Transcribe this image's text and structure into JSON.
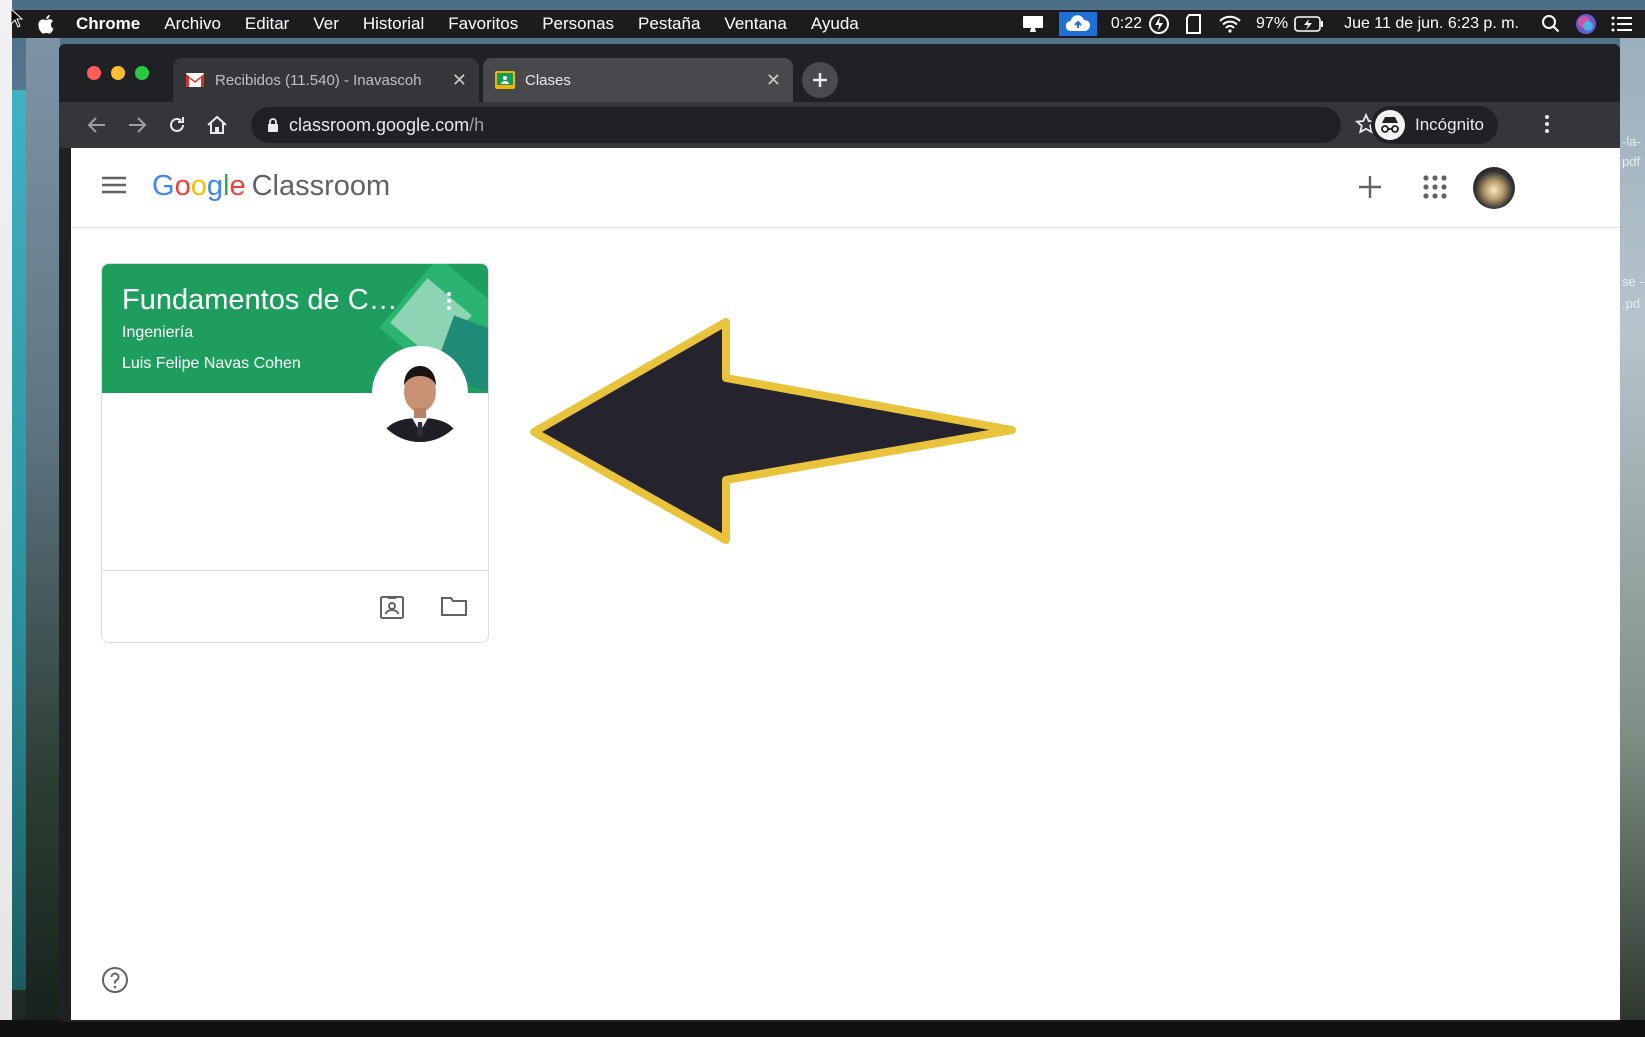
{
  "menubar": {
    "app": "Chrome",
    "items": [
      "Archivo",
      "Editar",
      "Ver",
      "Historial",
      "Favoritos",
      "Personas",
      "Pestaña",
      "Ventana",
      "Ayuda"
    ],
    "timer": "0:22",
    "battery": "97%",
    "datetime": "Jue 11 de jun.  6:23 p. m."
  },
  "browser": {
    "tabs": [
      {
        "title": "Recibidos (11.540) - Inavascoh",
        "icon": "gmail-icon"
      },
      {
        "title": "Clases",
        "icon": "classroom-icon"
      }
    ],
    "url_host": "classroom.google.com",
    "url_path": "/h",
    "profile_label": "Incógnito"
  },
  "classroom": {
    "logo_google": [
      "G",
      "o",
      "o",
      "g",
      "l",
      "e"
    ],
    "logo_colors": [
      "#4285F4",
      "#EA4335",
      "#FBBC05",
      "#4285F4",
      "#34A853",
      "#EA4335"
    ],
    "logo_product": "Classroom",
    "card": {
      "title": "Fundamentos de Cál...",
      "section": "Ingeniería",
      "teacher": "Luis Felipe Navas Cohen",
      "banner_color": "#1e9e5e"
    }
  },
  "annotation": {
    "arrow_fill": "#25242e",
    "arrow_stroke": "#e9c33c"
  },
  "desktop": {
    "file_snippets": [
      "-la-",
      "pdf",
      "se -",
      ".pd"
    ]
  }
}
